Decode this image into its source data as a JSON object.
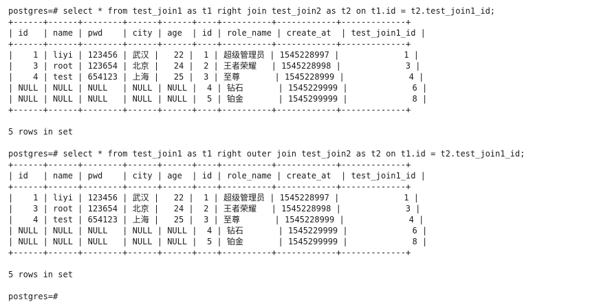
{
  "terminal": {
    "prompt": "postgres=#",
    "blocks": [
      {
        "command": "postgres=# select * from test_join1 as t1 right join test_join2 as t2 on t1.id = t2.test_join1_id;",
        "table_lines": [
          "+------+------+--------+------+------+----+----------+------------+-------------+",
          "| id   | name | pwd    | city | age  | id | role_name | create_at  | test_join1_id |",
          "+------+------+--------+------+------+----+----------+------------+-------------+",
          "|    1 | liyi | 123456 | 武汉 |   22 |  1 | 超级管理员 | 1545228997 |             1 |",
          "|    3 | root | 123654 | 北京 |   24 |  2 | 王者荣耀   | 1545228998 |             3 |",
          "|    4 | test | 654123 | 上海 |   25 |  3 | 至尊       | 1545228999 |             4 |",
          "| NULL | NULL | NULL   | NULL | NULL |  4 | 钻石       | 1545229999 |             6 |",
          "| NULL | NULL | NULL   | NULL | NULL |  5 | 铂金       | 1545299999 |             8 |",
          "+------+------+--------+------+------+----+----------+------------+-------------+"
        ],
        "result": "5 rows in set"
      },
      {
        "command": "postgres=# select * from test_join1 as t1 right outer join test_join2 as t2 on t1.id = t2.test_join1_id;",
        "table_lines": [
          "+------+------+--------+------+------+----+----------+------------+-------------+",
          "| id   | name | pwd    | city | age  | id | role_name | create_at  | test_join1_id |",
          "+------+------+--------+------+------+----+----------+------------+-------------+",
          "|    1 | liyi | 123456 | 武汉 |   22 |  1 | 超级管理员 | 1545228997 |             1 |",
          "|    3 | root | 123654 | 北京 |   24 |  2 | 王者荣耀   | 1545228998 |             3 |",
          "|    4 | test | 654123 | 上海 |   25 |  3 | 至尊       | 1545228999 |             4 |",
          "| NULL | NULL | NULL   | NULL | NULL |  4 | 钻石       | 1545229999 |             6 |",
          "| NULL | NULL | NULL   | NULL | NULL |  5 | 铂金       | 1545299999 |             8 |",
          "+------+------+--------+------+------+----+----------+------------+-------------+"
        ],
        "result": "5 rows in set"
      }
    ],
    "final_prompt": "postgres=#"
  }
}
